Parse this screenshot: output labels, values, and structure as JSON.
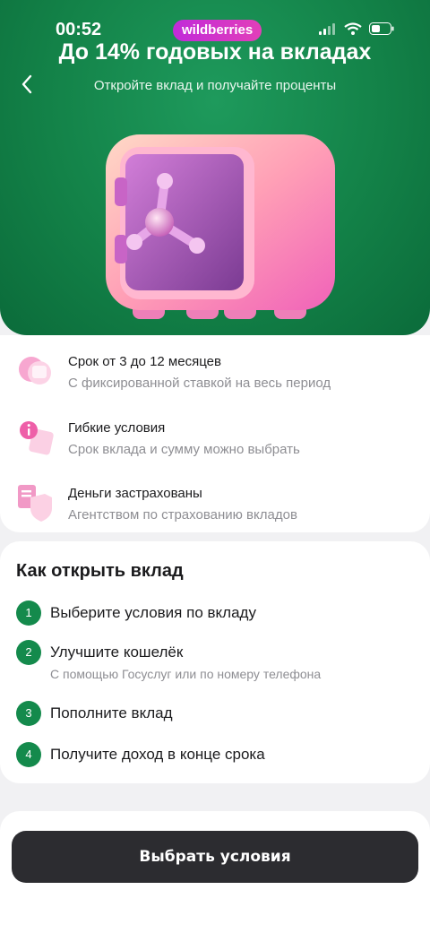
{
  "status_bar": {
    "time": "00:52",
    "brand": "wildberries"
  },
  "hero": {
    "title": "До 14% годовых на вкладах",
    "subtitle": "Откройте вклад и получайте проценты"
  },
  "features": [
    {
      "title": "Срок от 3 до 12 месяцев",
      "description": "С фиксированной ставкой на весь период",
      "icon": "calendar-icon"
    },
    {
      "title": "Гибкие условия",
      "description": "Срок вклада и сумму можно выбрать",
      "icon": "info-icon"
    },
    {
      "title": "Деньги застрахованы",
      "description": "Агентством по страхованию вкладов",
      "icon": "shield-icon"
    }
  ],
  "how_to": {
    "title": "Как открыть вклад",
    "steps": [
      {
        "number": "1",
        "text": "Выберите условия по вкладу"
      },
      {
        "number": "2",
        "text": "Улучшите кошелёк",
        "subtext": "С помощью Госуслуг или по номеру телефона"
      },
      {
        "number": "3",
        "text": "Пополните вклад"
      },
      {
        "number": "4",
        "text": "Получите доход в конце срока"
      }
    ]
  },
  "cta": {
    "label": "Выбрать условия"
  },
  "colors": {
    "hero_green": "#138248",
    "step_badge": "#148a4c",
    "cta_bg": "#2c2c30",
    "brand_pink": "#d02fc8"
  }
}
